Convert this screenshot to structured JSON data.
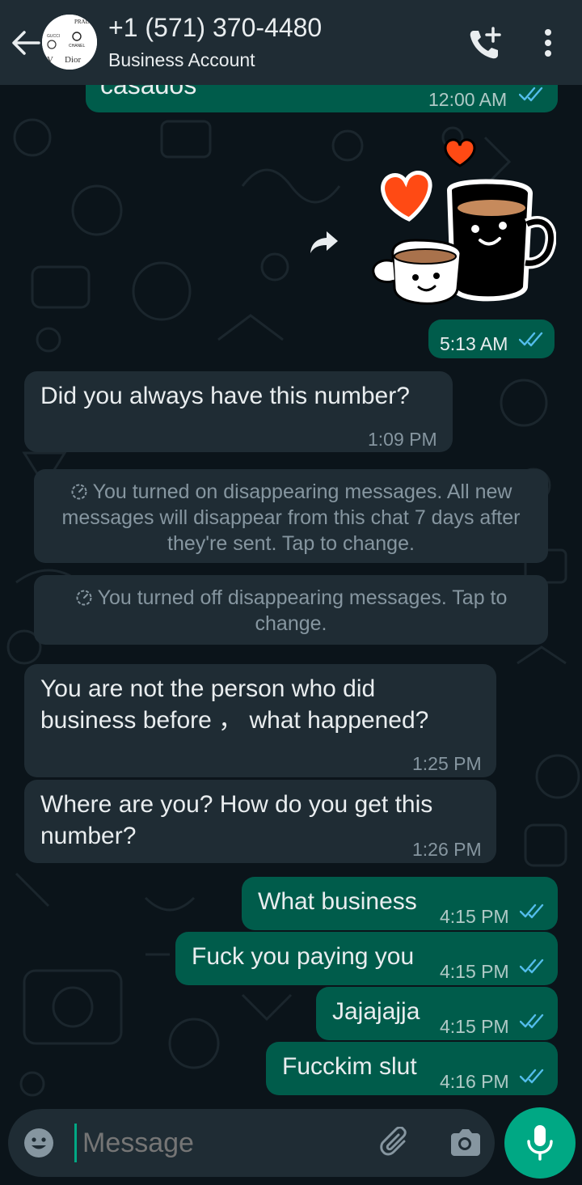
{
  "header": {
    "contact_name": "+1 (571) 370-4480",
    "subtitle": "Business Account",
    "avatar_brands": [
      "PRADA",
      "GUCCI",
      "CHANEL",
      "Dior"
    ]
  },
  "messages": [
    {
      "direction": "out",
      "text": "casados",
      "time": "12:00 AM",
      "read": true
    },
    {
      "direction": "out",
      "type": "sticker",
      "sticker": "coffee-cups-hearts-sticker",
      "time": "5:13 AM",
      "read": true
    },
    {
      "direction": "in",
      "text": "Did you always have this number?",
      "time": "1:09 PM"
    },
    {
      "type": "system",
      "text": "You turned on disappearing messages. All new messages will disappear from this chat 7 days after they're sent. Tap to change."
    },
    {
      "type": "system",
      "text": "You turned off disappearing messages. Tap to change."
    },
    {
      "direction": "in",
      "text_lines": [
        "You are not the person who did",
        "business before ，  what happened?"
      ],
      "time": "1:25 PM"
    },
    {
      "direction": "in",
      "text_lines": [
        "Where are you? How do you get this",
        "number?"
      ],
      "time": "1:26 PM"
    },
    {
      "direction": "out",
      "text": "What business",
      "time": "4:15 PM",
      "read": true
    },
    {
      "direction": "out",
      "text": "Fuck you paying you",
      "time": "4:15 PM",
      "read": true
    },
    {
      "direction": "out",
      "text": "Jajajajja",
      "time": "4:15 PM",
      "read": true
    },
    {
      "direction": "out",
      "text": "Fucckim slut",
      "time": "4:16 PM",
      "read": true
    }
  ],
  "composer": {
    "placeholder": "Message"
  },
  "icons": [
    "back-arrow-icon",
    "add-call-icon",
    "more-options-icon",
    "forward-icon",
    "emoji-icon",
    "attach-icon",
    "camera-icon",
    "mic-icon",
    "timer-icon",
    "double-check-icon"
  ],
  "colors": {
    "background": "#0b141a",
    "header": "#1f2c34",
    "outgoing_bubble": "#005c4b",
    "incoming_bubble": "#1f2c34",
    "accent": "#00a884",
    "read_ticks": "#53bdeb"
  }
}
